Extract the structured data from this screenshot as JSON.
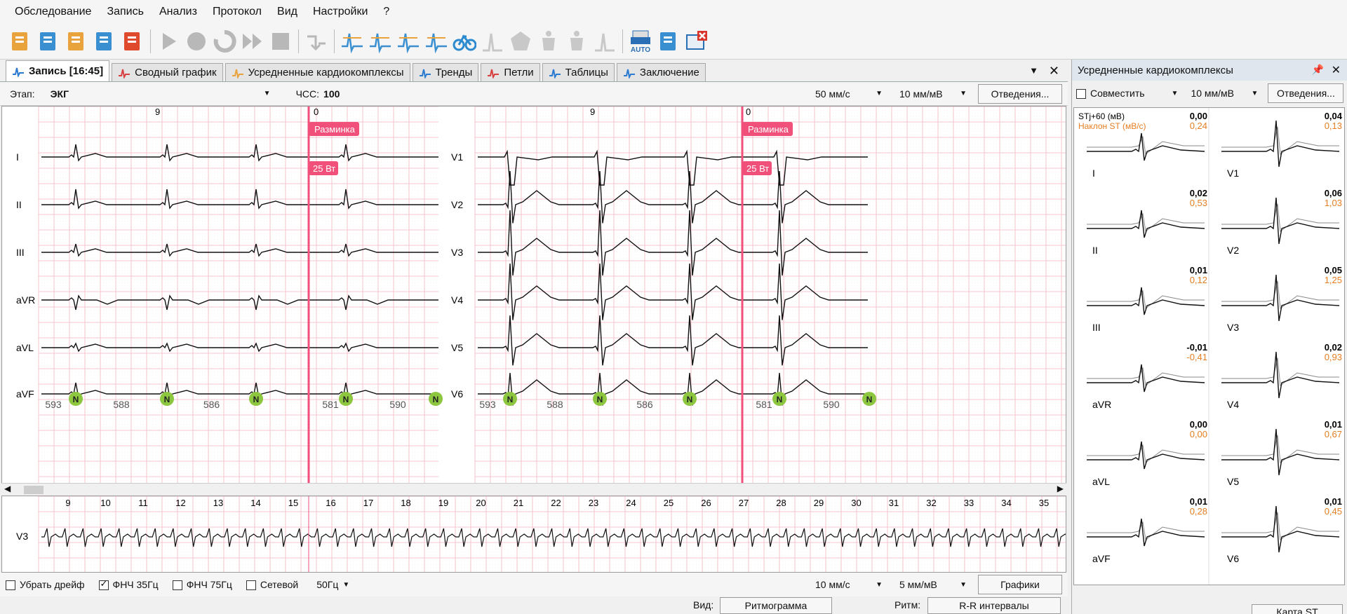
{
  "menu": [
    "Обследование",
    "Запись",
    "Анализ",
    "Протокол",
    "Вид",
    "Настройки",
    "?"
  ],
  "toolbar": {
    "icons": [
      "open-folder-icon",
      "new-record-icon",
      "import-icon",
      "save-icon",
      "export-icon",
      "play-icon",
      "record-icon",
      "replay-icon",
      "fast-forward-icon",
      "stop-icon",
      "step-down-icon",
      "find-peaks-icon",
      "intervals-icon",
      "amplitude-icon",
      "qt-icon",
      "bicycle-icon",
      "histogram-icon",
      "pentagon-icon",
      "body-icon",
      "body-back-icon",
      "spike-icon",
      "print-auto-icon",
      "report-icon",
      "close-window-icon"
    ],
    "auto_label": "AUTO"
  },
  "tabs": [
    {
      "label": "Запись [16:45]",
      "icon": "ecg-record-icon",
      "active": true
    },
    {
      "label": "Сводный график",
      "icon": "summary-chart-icon"
    },
    {
      "label": "Усредненные кардиокомплексы",
      "icon": "avg-complex-icon"
    },
    {
      "label": "Тренды",
      "icon": "trends-icon"
    },
    {
      "label": "Петли",
      "icon": "loops-icon"
    },
    {
      "label": "Таблицы",
      "icon": "tables-icon"
    },
    {
      "label": "Заключение",
      "icon": "conclusion-icon"
    }
  ],
  "stage": {
    "label": "Этап:",
    "value": "ЭКГ",
    "hr_label": "ЧСС:",
    "hr_value": "100",
    "speed": "50 мм/с",
    "gain": "10 мм/мВ",
    "leads_btn": "Отведения..."
  },
  "ecg": {
    "leads_left": [
      "I",
      "II",
      "III",
      "aVR",
      "aVL",
      "aVF"
    ],
    "leads_right": [
      "V1",
      "V2",
      "V3",
      "V4",
      "V5",
      "V6"
    ],
    "time_marks": [
      "9",
      "0"
    ],
    "event_stage": "Разминка",
    "event_load": "25 Вт",
    "beat_label": "N",
    "rr": [
      "593",
      "588",
      "586",
      "581",
      "590"
    ]
  },
  "rhythm": {
    "lead": "V3",
    "seconds": [
      "9",
      "10",
      "11",
      "12",
      "13",
      "14",
      "15",
      "16",
      "17",
      "18",
      "19",
      "20",
      "21",
      "22",
      "23",
      "24",
      "25",
      "26",
      "27",
      "28",
      "29",
      "30",
      "31",
      "32",
      "33",
      "34",
      "35"
    ]
  },
  "bottom": {
    "drift": "Убрать дрейф",
    "lpf35": "ФНЧ 35Гц",
    "lpf75": "ФНЧ 75Гц",
    "mains": "Сетевой",
    "mains_freq": "50Гц",
    "speed": "10 мм/с",
    "gain": "5 мм/мВ",
    "graphs_btn": "Графики",
    "view_label": "Вид:",
    "view_btn": "Ритмограмма",
    "rhythm_label": "Ритм:",
    "rhythm_btn": "R-R интервалы"
  },
  "right": {
    "title": "Усредненные кардиокомплексы",
    "combine": "Совместить",
    "gain": "10 мм/мВ",
    "leads_btn": "Отведения...",
    "hdr_st": "STj+60 (мВ)",
    "hdr_slope": "Наклон ST (мВ/с)",
    "map_btn": "Карта ST",
    "left": [
      {
        "lead": "I",
        "st": "0,00",
        "slope": "0,24"
      },
      {
        "lead": "II",
        "st": "0,02",
        "slope": "0,53"
      },
      {
        "lead": "III",
        "st": "0,01",
        "slope": "0,12"
      },
      {
        "lead": "aVR",
        "st": "-0,01",
        "slope": "-0,41"
      },
      {
        "lead": "aVL",
        "st": "0,00",
        "slope": "0,00"
      },
      {
        "lead": "aVF",
        "st": "0,01",
        "slope": "0,28"
      }
    ],
    "right": [
      {
        "lead": "V1",
        "st": "0,04",
        "slope": "0,13"
      },
      {
        "lead": "V2",
        "st": "0,06",
        "slope": "1,03"
      },
      {
        "lead": "V3",
        "st": "0,05",
        "slope": "1,25"
      },
      {
        "lead": "V4",
        "st": "0,02",
        "slope": "0,93"
      },
      {
        "lead": "V5",
        "st": "0,01",
        "slope": "0,67"
      },
      {
        "lead": "V6",
        "st": "0,01",
        "slope": "0,45"
      }
    ]
  },
  "colors": {
    "grid": "#f4b6c2",
    "event": "#f0507a",
    "beat": "#8dc63f",
    "slope": "#e67e22"
  }
}
